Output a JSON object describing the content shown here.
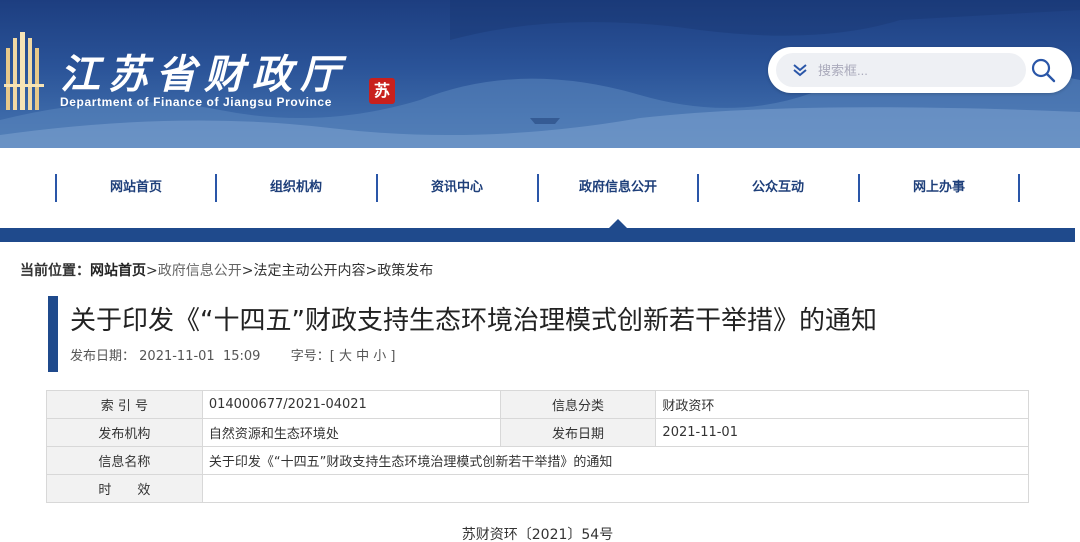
{
  "header": {
    "site_title_cn": "江苏省财政厅",
    "site_title_en": "Department of Finance of Jiangsu Province",
    "seal_char": "苏",
    "search": {
      "placeholder": "搜索框..."
    }
  },
  "nav": {
    "items": [
      {
        "label": "网站首页"
      },
      {
        "label": "组织机构"
      },
      {
        "label": "资讯中心"
      },
      {
        "label": "政府信息公开"
      },
      {
        "label": "公众互动"
      },
      {
        "label": "网上办事"
      }
    ],
    "active_index": 3
  },
  "breadcrumb": {
    "label": "当前位置：",
    "home": "网站首页",
    "sep": ">",
    "items": [
      "政府信息公开",
      "法定主动公开内容",
      "政策发布"
    ]
  },
  "article": {
    "title": "关于印发《“十四五”财政支持生态环境治理模式创新若干举措》的通知",
    "publish_label": "发布日期：",
    "publish_date": "2021-11-01  15:09",
    "font_size_label": "字号：[",
    "font_sizes": [
      "大",
      "中",
      "小"
    ],
    "font_size_close": "]",
    "doc_number": "苏财资环〔2021〕54号"
  },
  "info_table": {
    "rows": [
      {
        "k1": "索 引 号",
        "v1": "014000677/2021-04021",
        "k2": "信息分类",
        "v2": "财政资环"
      },
      {
        "k1": "发布机构",
        "v1": "自然资源和生态环境处",
        "k2": "发布日期",
        "v2": "2021-11-01"
      },
      {
        "k1": "信息名称",
        "v1": "关于印发《“十四五”财政支持生态环境治理模式创新若干举措》的通知"
      },
      {
        "k1": "时　　效",
        "v1": ""
      }
    ]
  },
  "colors": {
    "brand_blue": "#1f4a8c",
    "nav_text": "#1e3f7a",
    "seal_red": "#c8201d"
  },
  "icons": {
    "search": "search-icon",
    "dropdown": "chevron-down-icon",
    "emblem": "building-emblem-icon"
  }
}
